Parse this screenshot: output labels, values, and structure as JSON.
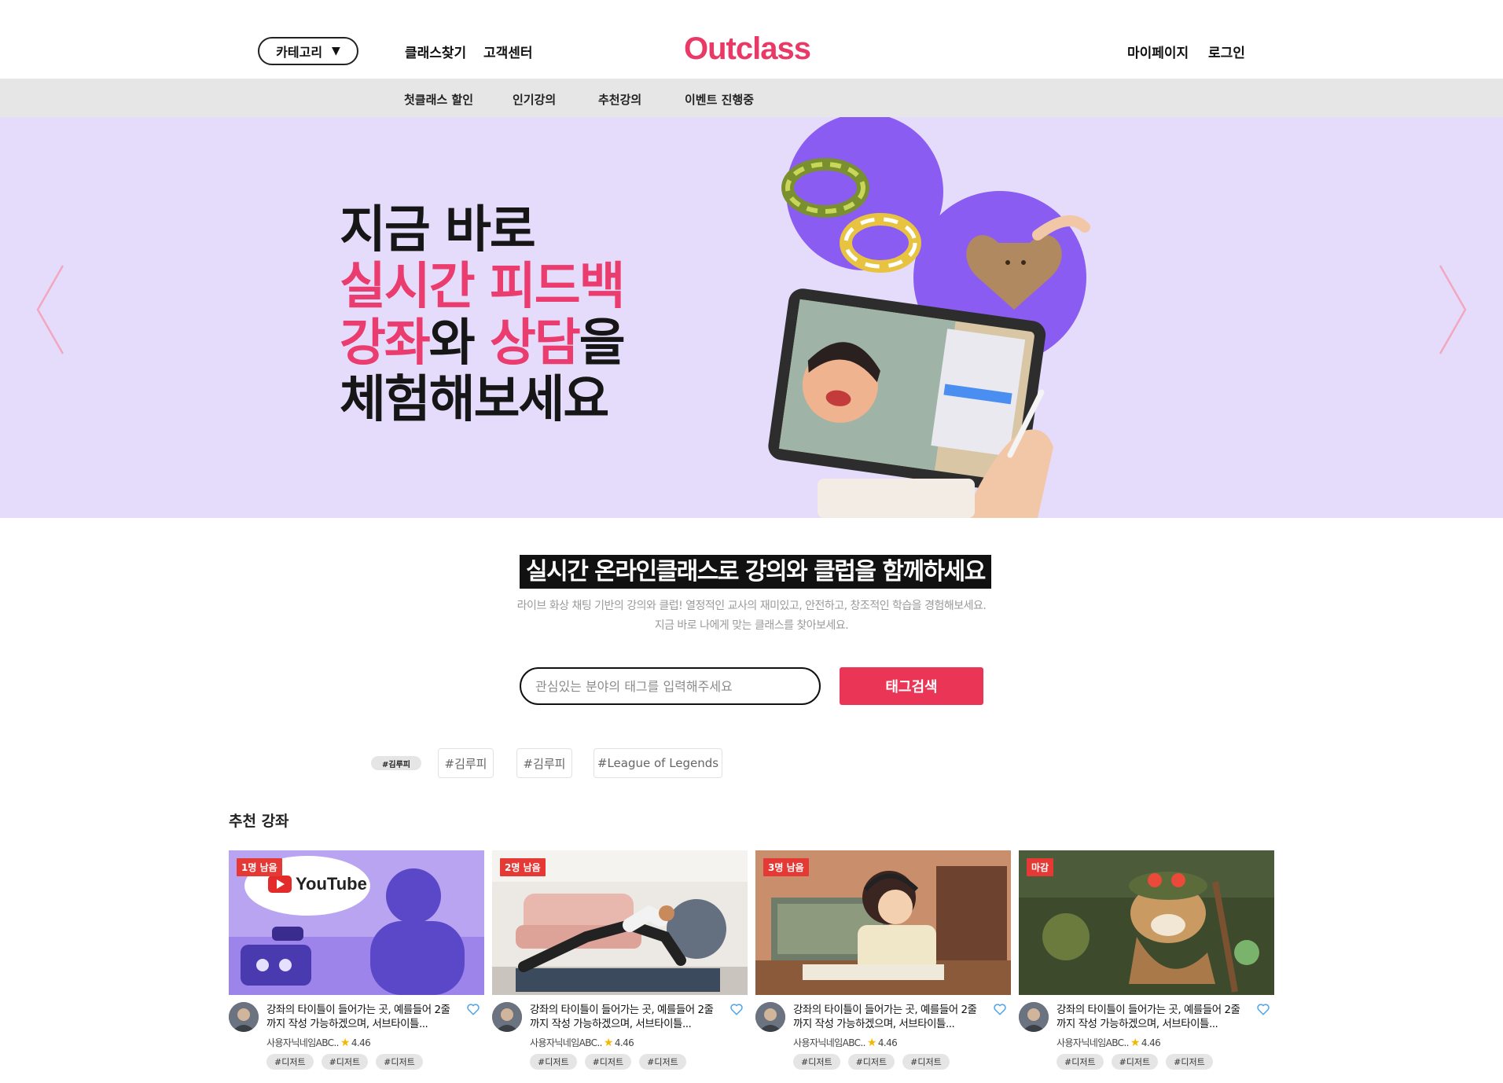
{
  "header": {
    "category_label": "카테고리",
    "category_caret": "▼",
    "nav": {
      "find_class": "클래스찾기",
      "support": "고객센터"
    },
    "logo": "Outclass",
    "mypage": "마이페이지",
    "login": "로그인"
  },
  "subnav": [
    "첫클래스 할인",
    "인기강의",
    "추천강의",
    "이벤트 진행중"
  ],
  "hero": {
    "line1": "지금 바로",
    "line2": "실시간 피드백",
    "line3_a": "강좌",
    "line3_b": "와 ",
    "line3_c": "상담",
    "line3_d": "을",
    "line4": "체험해보세요",
    "accent_color": "#ea3c6e",
    "background": "#e5dcfb"
  },
  "intro": {
    "title": "실시간 온라인클래스로 강의와 클럽을 함께하세요",
    "desc1": "라이브 화상 채팅 기반의 강의와 클럽! 열정적인 교사의 재미있고, 안전하고, 창조적인 학습을 경험해보세요.",
    "desc2": "지금 바로 나에게 맞는 클래스를 찾아보세요."
  },
  "search": {
    "placeholder": "관심있는 분야의 태그를 입력해주세요",
    "value": "",
    "button": "태그검색"
  },
  "tags": [
    "#김루피",
    "#김루피",
    "#김루피",
    "#League of Legends"
  ],
  "recommended": {
    "title": "추천 강좌",
    "cards": [
      {
        "badge": "1명 남음",
        "title": "강좌의 타이틀이 들어가는 곳, 예를들어 2줄까지 작성 가능하겠으며, 서브타이틀...",
        "author": "사용자닉네임ABC..",
        "rating": "4.46",
        "chips": [
          "#디저트",
          "#디저트",
          "#디저트"
        ]
      },
      {
        "badge": "2명 남음",
        "title": "강좌의 타이틀이 들어가는 곳, 예를들어 2줄까지 작성 가능하겠으며, 서브타이틀...",
        "author": "사용자닉네임ABC..",
        "rating": "4.46",
        "chips": [
          "#디저트",
          "#디저트",
          "#디저트"
        ]
      },
      {
        "badge": "3명 남음",
        "title": "강좌의 타이틀이 들어가는 곳, 예를들어 2줄까지 작성 가능하겠으며, 서브타이틀...",
        "author": "사용자닉네임ABC..",
        "rating": "4.46",
        "chips": [
          "#디저트",
          "#디저트",
          "#디저트"
        ]
      },
      {
        "badge": "마감",
        "title": "강좌의 타이틀이 들어가는 곳, 예를들어 2줄까지 작성 가능하겠으며, 서브타이틀...",
        "author": "사용자닉네임ABC..",
        "rating": "4.46",
        "chips": [
          "#디저트",
          "#디저트",
          "#디저트"
        ]
      }
    ],
    "thumb_icons": [
      "youtube-video-illustration",
      "workout-photo",
      "anime-study-illustration",
      "game-character-illustration"
    ]
  }
}
